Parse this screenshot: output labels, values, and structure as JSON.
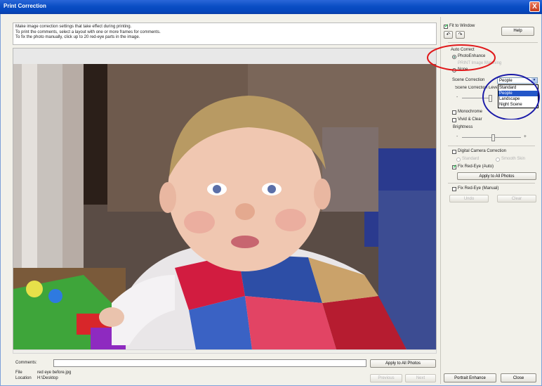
{
  "window": {
    "title": "Print Correction",
    "close_glyph": "X"
  },
  "info_text": [
    "Make image correction settings that take effect during printing.",
    "To print the comments, select a layout with one or more frames for comments.",
    "To fix the photo manually, click up to 20 red-eye parts in the image."
  ],
  "bottom": {
    "comments_label": "Comments:",
    "comments_value": "",
    "apply_button": "Apply to All Photos",
    "file_label": "File",
    "file_value": "red eye before.jpg",
    "location_label": "Location",
    "location_value": "H:\\Desktop",
    "previous_button": "Previous",
    "next_button": "Next"
  },
  "right": {
    "fit_to_window": "Fit to Window",
    "fit_checked": true,
    "help_button": "Help",
    "auto_correct_label": "Auto Correct",
    "photoenhance": "PhotoEnhance",
    "print_image_matching": "PRINT Image Matching",
    "none": "None",
    "scene_correction_label": "Scene Correction",
    "scene_selected": "People",
    "scene_options": [
      "Standard",
      "People",
      "Landscape",
      "Night Scene"
    ],
    "scene_correction_level": "Scene Correction Level",
    "monochrome": "Monochrome",
    "vivid_clear": "Vivid & Clear",
    "brightness_label": "Brightness",
    "digital_camera_correction": "Digital Camera Correction",
    "standard_option": "Standard",
    "smooth_skin_option": "Smooth Skin",
    "fix_red_eye_auto": "Fix Red-Eye (Auto)",
    "fix_red_eye_auto_checked": true,
    "apply_all_button": "Apply to All Photos",
    "fix_red_eye_manual": "Fix Red-Eye (Manual)",
    "undo_button": "Undo",
    "clear_button": "Clear",
    "portrait_enhance_button": "Portrait Enhance",
    "close_button": "Close"
  },
  "annotations": {
    "red_ellipse_color": "#e0181a",
    "blue_ellipse_color": "#1a1aa8"
  }
}
